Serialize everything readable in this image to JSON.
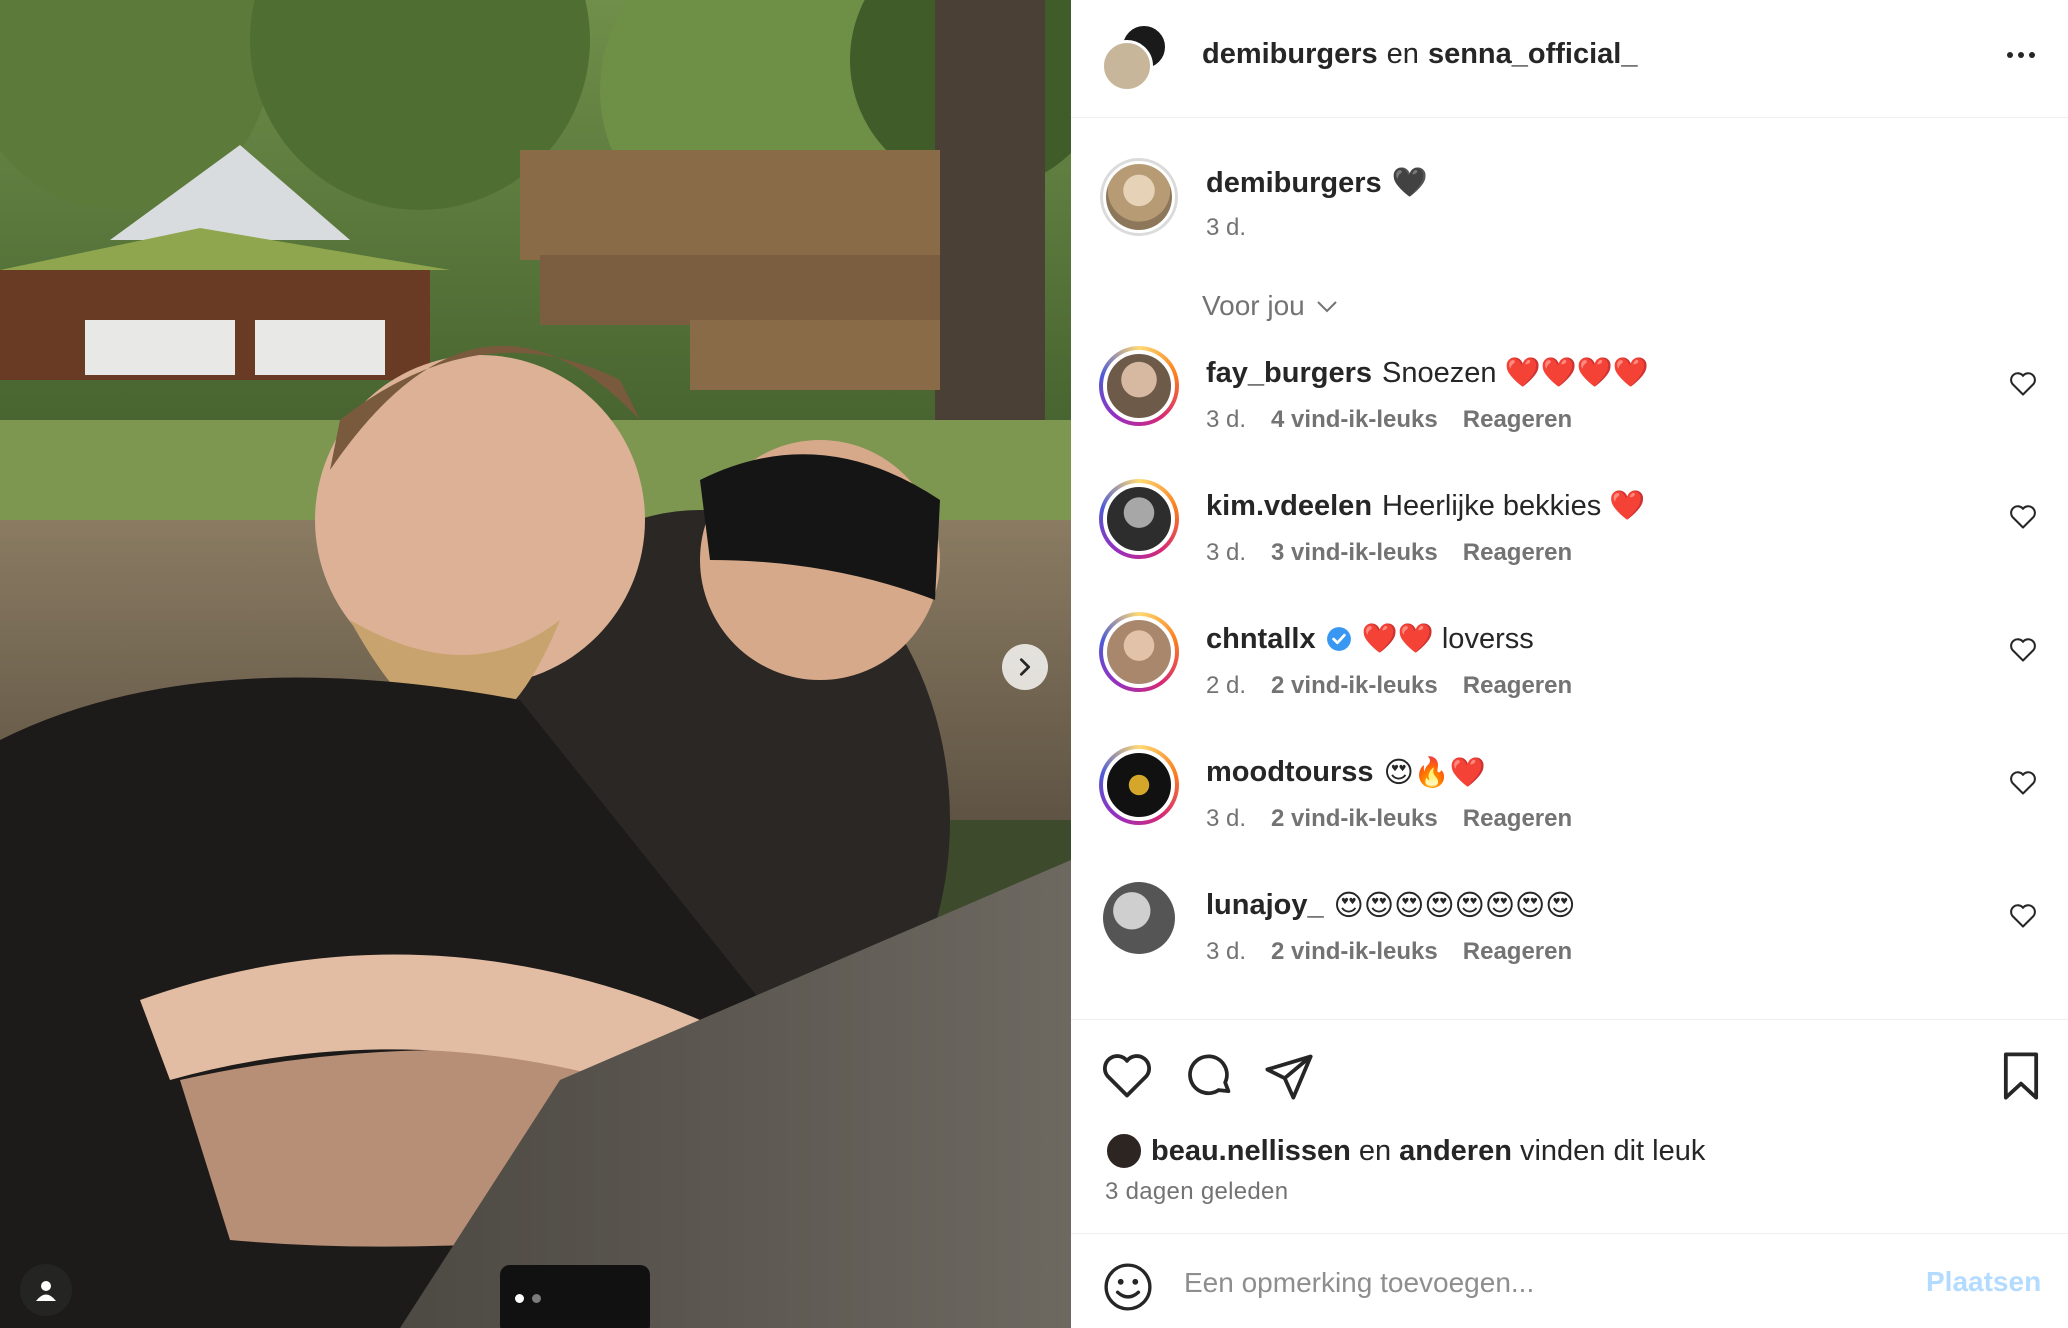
{
  "header": {
    "user1": "demiburgers",
    "conjunction": "en",
    "user2": "senna_official_",
    "more_icon": "more-horizontal-icon"
  },
  "caption": {
    "username": "demiburgers",
    "text": "🖤",
    "time": "3 d."
  },
  "filter": {
    "label": "Voor jou",
    "icon": "chevron-down-icon"
  },
  "comments": [
    {
      "username": "fay_burgers",
      "text": "Snoezen ❤️❤️❤️❤️",
      "time": "3 d.",
      "likes": "4 vind-ik-leuks",
      "reply": "Reageren",
      "verified": false
    },
    {
      "username": "kim.vdeelen",
      "text": "Heerlijke bekkies ❤️",
      "time": "3 d.",
      "likes": "3 vind-ik-leuks",
      "reply": "Reageren",
      "verified": false
    },
    {
      "username": "chntallx",
      "text": "❤️❤️ loverss",
      "time": "2 d.",
      "likes": "2 vind-ik-leuks",
      "reply": "Reageren",
      "verified": true
    },
    {
      "username": "moodtourss",
      "text": "😍🔥❤️",
      "time": "3 d.",
      "likes": "2 vind-ik-leuks",
      "reply": "Reageren",
      "verified": false
    },
    {
      "username": "lunajoy_",
      "text": "😍😍😍😍😍😍😍😍",
      "time": "3 d.",
      "likes": "2 vind-ik-leuks",
      "reply": "Reageren",
      "verified": false
    }
  ],
  "likes_line": {
    "user": "beau.nellissen",
    "and": "en",
    "others": "anderen",
    "suffix": "vinden dit leuk"
  },
  "post_date": "3 dagen geleden",
  "composer": {
    "placeholder": "Een opmerking toevoegen...",
    "post_label": "Plaatsen"
  },
  "carousel": {
    "current": 1,
    "total": 2
  },
  "colors": {
    "text": "#262626",
    "muted": "#737373",
    "link_disabled": "#b3dbff",
    "verified": "#3897f0",
    "border": "#efefef"
  }
}
